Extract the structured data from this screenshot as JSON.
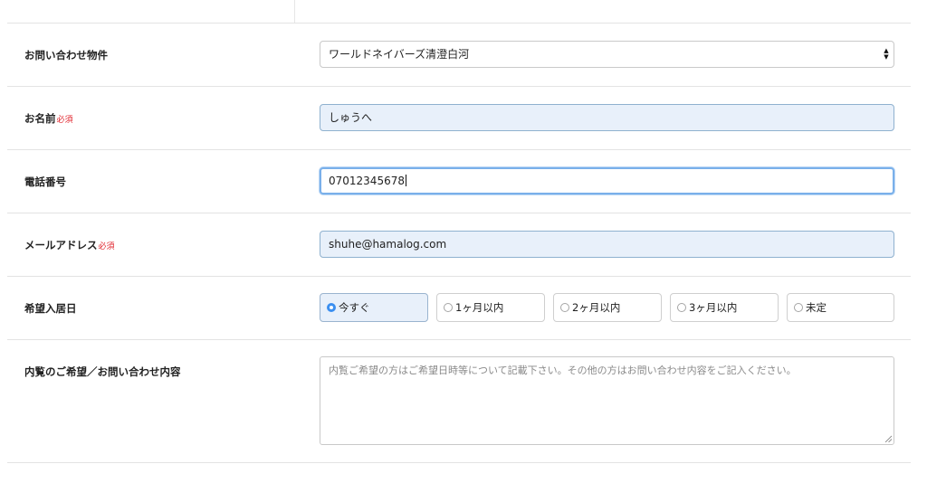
{
  "form": {
    "property": {
      "label": "お問い合わせ物件",
      "selected_value": "ワールドネイバーズ清澄白河"
    },
    "name": {
      "label": "お名前",
      "required": "必須",
      "value": "しゅうへ"
    },
    "phone": {
      "label": "電話番号",
      "value": "07012345678"
    },
    "email": {
      "label": "メールアドレス",
      "required": "必須",
      "value": "shuhe@hamalog.com"
    },
    "move_in": {
      "label": "希望入居日",
      "options": [
        "今すぐ",
        "1ヶ月以内",
        "2ヶ月以内",
        "3ヶ月以内",
        "未定"
      ],
      "selected": "今すぐ"
    },
    "message": {
      "label": "内覧のご希望／お問い合わせ内容",
      "placeholder": "内覧ご希望の方はご希望日時等について記載下さい。その他の方はお問い合わせ内容をご記入ください。"
    }
  },
  "colors": {
    "required": "#e0242c",
    "autofill_bg": "#e8f0fa",
    "focus_ring": "#7ab0ea",
    "radio_selected": "#3b8ff0"
  },
  "icons": {
    "select_arrows": "updown-chevron-icon",
    "radio": "radio-icon",
    "resize": "resize-grip-icon"
  }
}
